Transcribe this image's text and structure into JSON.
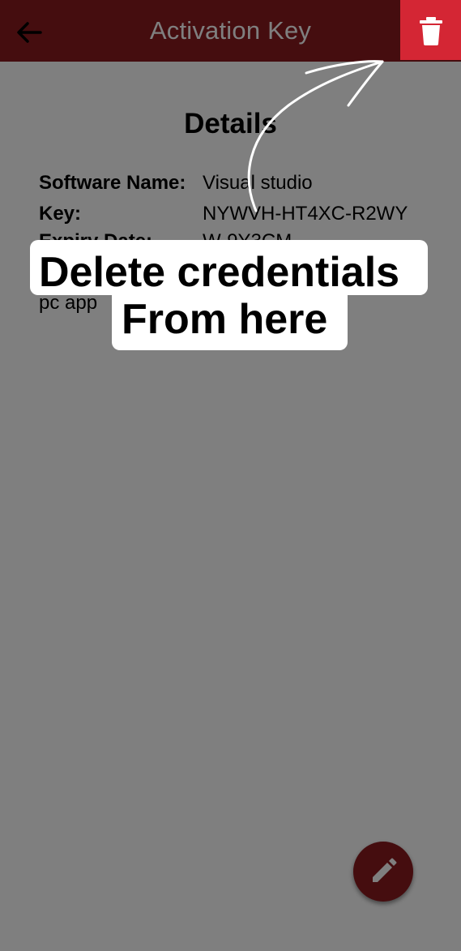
{
  "appbar": {
    "title": "Activation Key",
    "back_icon": "arrow-left-icon",
    "delete_icon": "trash-icon",
    "accent": "#8b1a1f",
    "delete_color": "#cf2433"
  },
  "details": {
    "heading": "Details",
    "software_label": "Software Name:",
    "software_value": "Visual studio",
    "key_label": "Key:",
    "key_value": "NYWVH-HT4XC-R2WY",
    "expiry_label": "Expiry Date:",
    "expiry_value": "W-9Y3CM",
    "description": "pc app"
  },
  "fab": {
    "icon": "pencil-icon"
  },
  "tutorial": {
    "line1": "Delete credentials",
    "line2": "From here",
    "arrow_icon": "curved-arrow-icon"
  }
}
